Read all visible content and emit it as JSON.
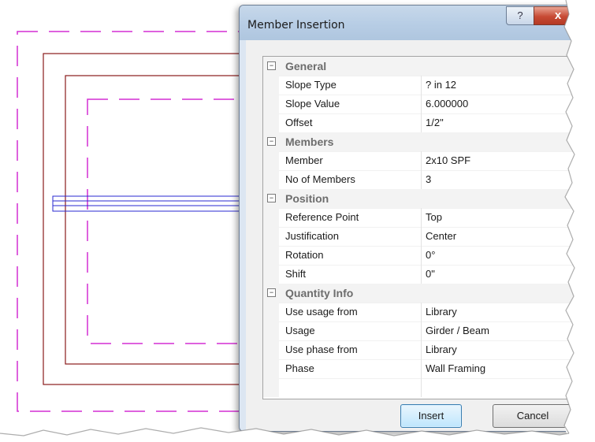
{
  "dialog": {
    "title": "Member Insertion",
    "help_label": "?",
    "close_label": "x",
    "insert_label": "Insert",
    "cancel_label": "Cancel"
  },
  "groups": [
    {
      "label": "General",
      "toggle": "⊟",
      "props": [
        {
          "name": "Slope Type",
          "value": "? in 12"
        },
        {
          "name": "Slope Value",
          "value": "6.000000"
        },
        {
          "name": "Offset",
          "value": "1/2\""
        }
      ]
    },
    {
      "label": "Members",
      "toggle": "⊟",
      "props": [
        {
          "name": "Member",
          "value": "2x10 SPF"
        },
        {
          "name": "No of Members",
          "value": "3"
        }
      ]
    },
    {
      "label": "Position",
      "toggle": "⊟",
      "props": [
        {
          "name": "Reference Point",
          "value": "Top"
        },
        {
          "name": "Justification",
          "value": "Center"
        },
        {
          "name": "Rotation",
          "value": "0°"
        },
        {
          "name": "Shift",
          "value": "0\""
        }
      ]
    },
    {
      "label": "Quantity Info",
      "toggle": "⊟",
      "props": [
        {
          "name": "Use usage from",
          "value": "Library"
        },
        {
          "name": "Usage",
          "value": "Girder / Beam"
        },
        {
          "name": "Use phase from",
          "value": "Library"
        },
        {
          "name": "Phase",
          "value": "Wall Framing"
        }
      ]
    }
  ],
  "colors": {
    "dashed_outline": "#d42fd4",
    "wall_line": "#8a1a1a",
    "beam_line": "#2a2ad0"
  }
}
